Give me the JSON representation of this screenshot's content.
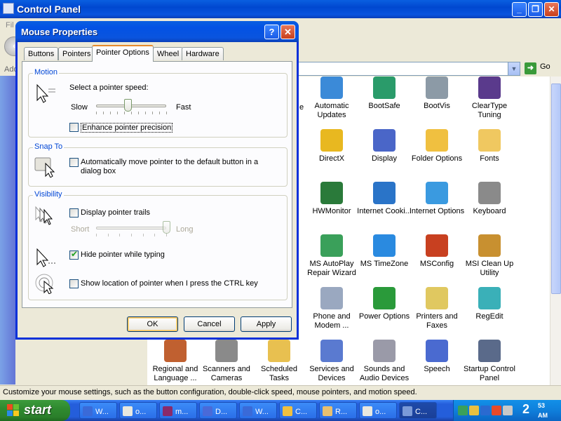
{
  "control_panel": {
    "title": "Control Panel",
    "menu_first": "Fil",
    "address_label": "Add",
    "go_label": "Go",
    "statusbar": "Customize your mouse settings, such as the button configuration, double-click speed, mouse pointers, and motion speed.",
    "items": [
      {
        "label": "e",
        "icon": "partial-icon",
        "color": "#ffffff"
      },
      {
        "label": "Automatic Updates",
        "icon": "automatic-updates-icon",
        "color": "#3b8ad8"
      },
      {
        "label": "BootSafe",
        "icon": "bootsafe-icon",
        "color": "#2a9b6a"
      },
      {
        "label": "BootVis",
        "icon": "bootvis-icon",
        "color": "#8c9aa6"
      },
      {
        "label": "ClearType Tuning",
        "icon": "cleartype-tuning-icon",
        "color": "#5a3a8c"
      },
      {
        "label": "DirectX",
        "icon": "directx-icon",
        "color": "#e8b820"
      },
      {
        "label": "Display",
        "icon": "display-icon",
        "color": "#4a66c8"
      },
      {
        "label": "Folder Options",
        "icon": "folder-options-icon",
        "color": "#f0c040"
      },
      {
        "label": "Fonts",
        "icon": "fonts-icon",
        "color": "#f0c860"
      },
      {
        "label": "HWMonitor",
        "icon": "hwmonitor-icon",
        "color": "#2a7a3a"
      },
      {
        "label": "Internet Cooki...",
        "icon": "internet-cookies-icon",
        "color": "#2a74c8"
      },
      {
        "label": "Internet Options",
        "icon": "internet-options-icon",
        "color": "#3a9ae0"
      },
      {
        "label": "Keyboard",
        "icon": "keyboard-icon",
        "color": "#8a8a8a"
      },
      {
        "label": "MS AutoPlay Repair Wizard",
        "icon": "autoplay-repair-icon",
        "color": "#3aa05a"
      },
      {
        "label": "MS TimeZone",
        "icon": "timezone-icon",
        "color": "#2a8ae0"
      },
      {
        "label": "MSConfig",
        "icon": "msconfig-icon",
        "color": "#c84020"
      },
      {
        "label": "MSI Clean Up Utility",
        "icon": "msi-cleanup-icon",
        "color": "#c89030"
      },
      {
        "label": "Phone and Modem ...",
        "icon": "phone-modem-icon",
        "color": "#9aa8c0"
      },
      {
        "label": "Power Options",
        "icon": "power-options-icon",
        "color": "#2a9a3a"
      },
      {
        "label": "Printers and Faxes",
        "icon": "printers-faxes-icon",
        "color": "#e0c860"
      },
      {
        "label": "RegEdit",
        "icon": "regedit-icon",
        "color": "#3ab0b8"
      },
      {
        "label": "Regional and Language ...",
        "icon": "regional-language-icon",
        "color": "#c06030"
      },
      {
        "label": "Scanners and Cameras",
        "icon": "scanners-cameras-icon",
        "color": "#8a8a8a"
      },
      {
        "label": "Scheduled Tasks",
        "icon": "scheduled-tasks-icon",
        "color": "#e8c050"
      },
      {
        "label": "Services and Devices",
        "icon": "services-devices-icon",
        "color": "#5a7ad0"
      },
      {
        "label": "Sounds and Audio Devices",
        "icon": "sounds-audio-icon",
        "color": "#9a9aa8"
      },
      {
        "label": "Speech",
        "icon": "speech-icon",
        "color": "#4a6ad0"
      },
      {
        "label": "Startup Control Panel",
        "icon": "startup-control-panel-icon",
        "color": "#5a6a8a"
      }
    ]
  },
  "dialog": {
    "title": "Mouse Properties",
    "tabs": [
      "Buttons",
      "Pointers",
      "Pointer Options",
      "Wheel",
      "Hardware"
    ],
    "active_tab": "Pointer Options",
    "motion": {
      "title": "Motion",
      "speed_label": "Select a pointer speed:",
      "slow": "Slow",
      "fast": "Fast",
      "speed_level": 0.45,
      "precision_label": "Enhance pointer precision",
      "precision_checked": false
    },
    "snap_to": {
      "title": "Snap To",
      "label_line1": "Automatically move pointer to the default button in a",
      "label_line2": "dialog box",
      "checked": false
    },
    "visibility": {
      "title": "Visibility",
      "trails_label": "Display pointer trails",
      "trails_checked": false,
      "short": "Short",
      "long": "Long",
      "trail_level": 1.0,
      "hide_label": "Hide pointer while typing",
      "hide_checked": true,
      "ctrl_label": "Show location of pointer when I press the CTRL key",
      "ctrl_checked": false
    },
    "buttons": {
      "ok": "OK",
      "cancel": "Cancel",
      "apply": "Apply"
    }
  },
  "taskbar": {
    "start": "start",
    "tasks": [
      {
        "label": "W...",
        "color": "#3a6ad8"
      },
      {
        "label": "o...",
        "color": "#e8e8e0"
      },
      {
        "label": "m...",
        "color": "#8a2a6a"
      },
      {
        "label": "D...",
        "color": "#4a6ad8"
      },
      {
        "label": "W...",
        "color": "#3a6ad8"
      },
      {
        "label": "C...",
        "color": "#f0c040"
      },
      {
        "label": "R...",
        "color": "#e8c070"
      },
      {
        "label": "o...",
        "color": "#e8e8e0"
      },
      {
        "label": "C...",
        "color": "#7a9ad8"
      }
    ],
    "clock_hour": "2",
    "clock_min": "53",
    "clock_ampm": "AM"
  }
}
